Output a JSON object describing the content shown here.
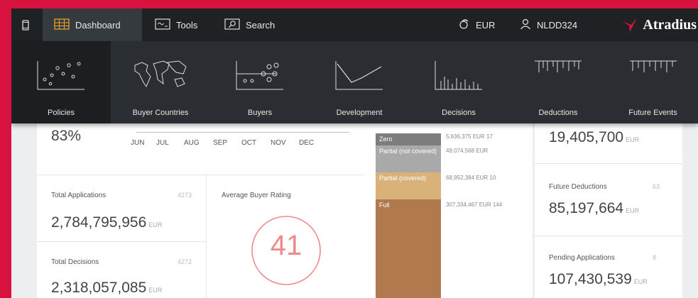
{
  "topbar": {
    "dashboard": "Dashboard",
    "tools": "Tools",
    "search": "Search",
    "currency": "EUR",
    "user": "NLDD324",
    "brand": "Atradius"
  },
  "nav": [
    {
      "label": "Policies"
    },
    {
      "label": "Buyer Countries"
    },
    {
      "label": "Buyers"
    },
    {
      "label": "Development"
    },
    {
      "label": "Decisions"
    },
    {
      "label": "Deductions"
    },
    {
      "label": "Future Events"
    }
  ],
  "left": {
    "percent": "83%",
    "months": [
      "JUN",
      "JUL",
      "AUG",
      "SEP",
      "OCT",
      "NOV",
      "DEC"
    ],
    "applications": {
      "title": "Total Applications",
      "count": "4273",
      "value": "2,784,795,956",
      "unit": "EUR"
    },
    "rating": {
      "title": "Average Buyer Rating",
      "value": "41"
    },
    "decisions": {
      "title": "Total Decisions",
      "count": "4272",
      "value": "2,318,057,085",
      "unit": "EUR"
    }
  },
  "decision_bars": [
    {
      "label": "Zero",
      "value": "5,636,375 EUR 17",
      "color": "#7d7d7d"
    },
    {
      "label": "Partial (not covered)",
      "value": "49,074,568 EUR",
      "color": "#a9a9a9"
    },
    {
      "label": "Partial (covered)",
      "value": "68,952,384 EUR 10",
      "color": "#d9b27a"
    },
    {
      "label": "Full",
      "value": "307,334,467 EUR 144",
      "color": "#b07a4e"
    }
  ],
  "right": {
    "top_value": "19,405,700",
    "top_unit": "EUR",
    "future": {
      "title": "Future Deductions",
      "count": "63",
      "value": "85,197,664",
      "unit": "EUR"
    },
    "pending": {
      "title": "Pending Applications",
      "count": "8",
      "value": "107,430,539",
      "unit": "EUR"
    }
  },
  "colors": {
    "brand_red": "#d8123e",
    "ring": "#f08a8a"
  }
}
